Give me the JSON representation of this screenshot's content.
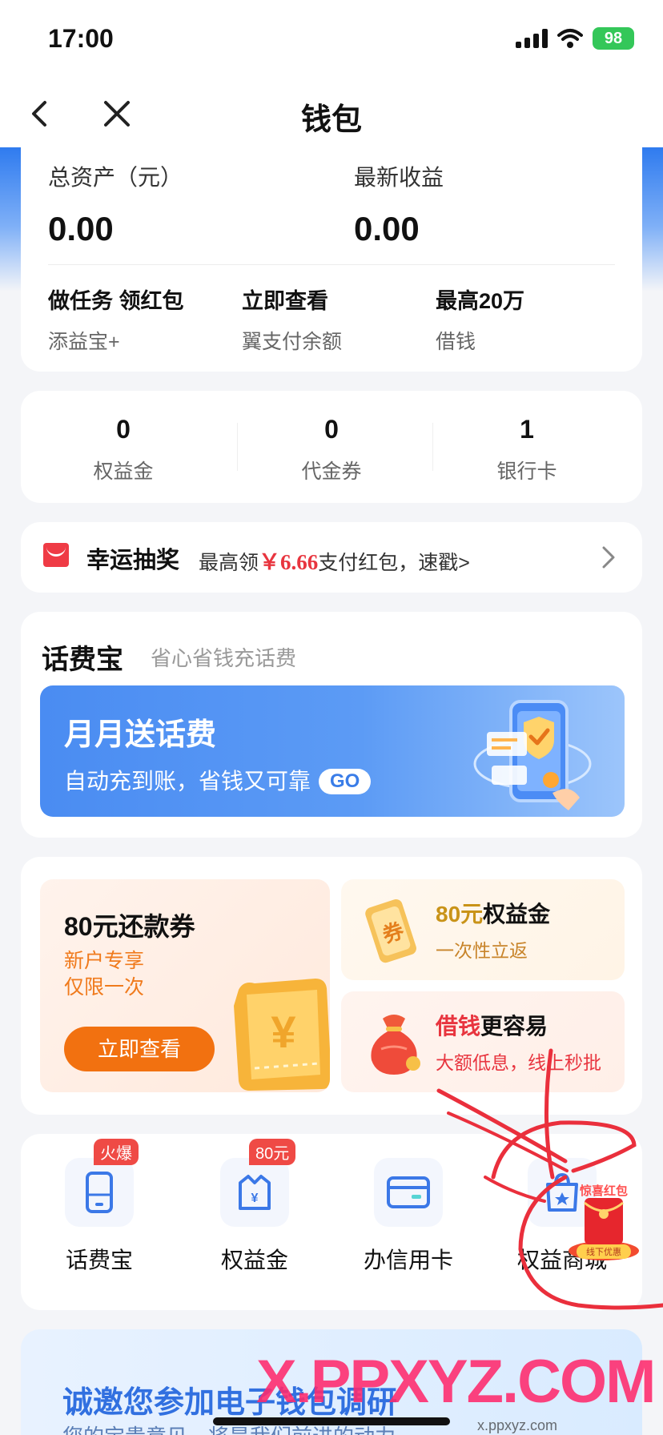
{
  "status_bar": {
    "time": "17:00",
    "battery": "98"
  },
  "nav": {
    "title": "钱包"
  },
  "assets": {
    "total_label": "总资产（元）",
    "total_value": "0.00",
    "earnings_label": "最新收益",
    "earnings_value": "0.00",
    "links": [
      {
        "title": "做任务 领红包",
        "sub": "添益宝+"
      },
      {
        "title": "立即查看",
        "sub": "翼支付余额"
      },
      {
        "title": "最高20万",
        "sub": "借钱"
      }
    ]
  },
  "stats": [
    {
      "value": "0",
      "label": "权益金"
    },
    {
      "value": "0",
      "label": "代金券"
    },
    {
      "value": "1",
      "label": "银行卡"
    }
  ],
  "lottery": {
    "title": "幸运抽奖",
    "text_before": "最高领",
    "amount": "￥6.66",
    "text_after": "支付红包，速戳>"
  },
  "huafeibao": {
    "title": "话费宝",
    "subtitle": "省心省钱充话费",
    "banner_title": "月月送话费",
    "banner_sub": "自动充到账，省钱又可靠",
    "banner_go": "GO"
  },
  "promos": {
    "left": {
      "title": "80元还款券",
      "line1": "新户专享",
      "line2": "仅限一次",
      "button": "立即查看"
    },
    "right_top": {
      "title_accent": "80元",
      "title_rest": "权益金",
      "sub": "一次性立返"
    },
    "right_bottom": {
      "title_accent": "借钱",
      "title_rest": "更容易",
      "sub": "大额低息，线上秒批"
    },
    "coupon_char": "¥",
    "ticket_char": "券"
  },
  "services": [
    {
      "label": "话费宝",
      "badge": "火爆",
      "icon": "phone-icon"
    },
    {
      "label": "权益金",
      "badge": "80元",
      "icon": "gift-icon"
    },
    {
      "label": "办信用卡",
      "badge": "",
      "icon": "credit-card-icon"
    },
    {
      "label": "权益商城",
      "badge": "",
      "icon": "shopping-bag-icon"
    }
  ],
  "floating": {
    "title": "惊喜红包",
    "sub": "线下优惠"
  },
  "survey": {
    "title": "诚邀您参加电子钱包调研",
    "sub": "您的宝贵意见，将是我们前进的动力"
  },
  "watermark": {
    "main": "X.PPXYZ.COM",
    "sub": "x.ppxyz.com"
  },
  "colors": {
    "brand_blue": "#2f7bef",
    "accent_red": "#e8353f",
    "accent_orange": "#f27110",
    "ink_red": "#ea2f3c"
  }
}
